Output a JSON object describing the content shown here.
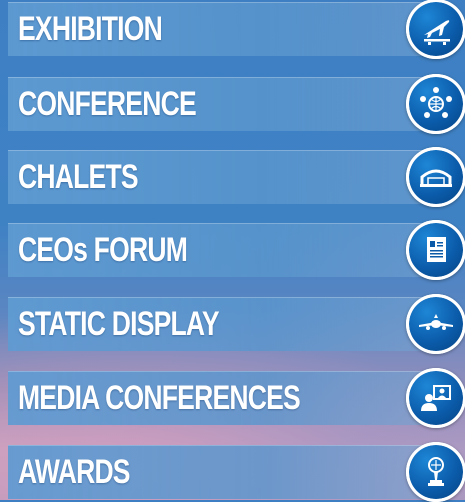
{
  "menu": {
    "items": [
      {
        "label": "EXHIBITION",
        "icon": "airplane-takeoff-icon"
      },
      {
        "label": "CONFERENCE",
        "icon": "conference-table-icon"
      },
      {
        "label": "CHALETS",
        "icon": "hangar-icon"
      },
      {
        "label": "CEOs FORUM",
        "icon": "document-icon"
      },
      {
        "label": "STATIC DISPLAY",
        "icon": "airliner-front-icon"
      },
      {
        "label": "MEDIA CONFERENCES",
        "icon": "video-call-icon"
      },
      {
        "label": "AWARDS",
        "icon": "trophy-icon"
      }
    ]
  },
  "colors": {
    "bar": "#5b9bd2",
    "badge": "#0a5aa8",
    "text": "#ffffff"
  }
}
